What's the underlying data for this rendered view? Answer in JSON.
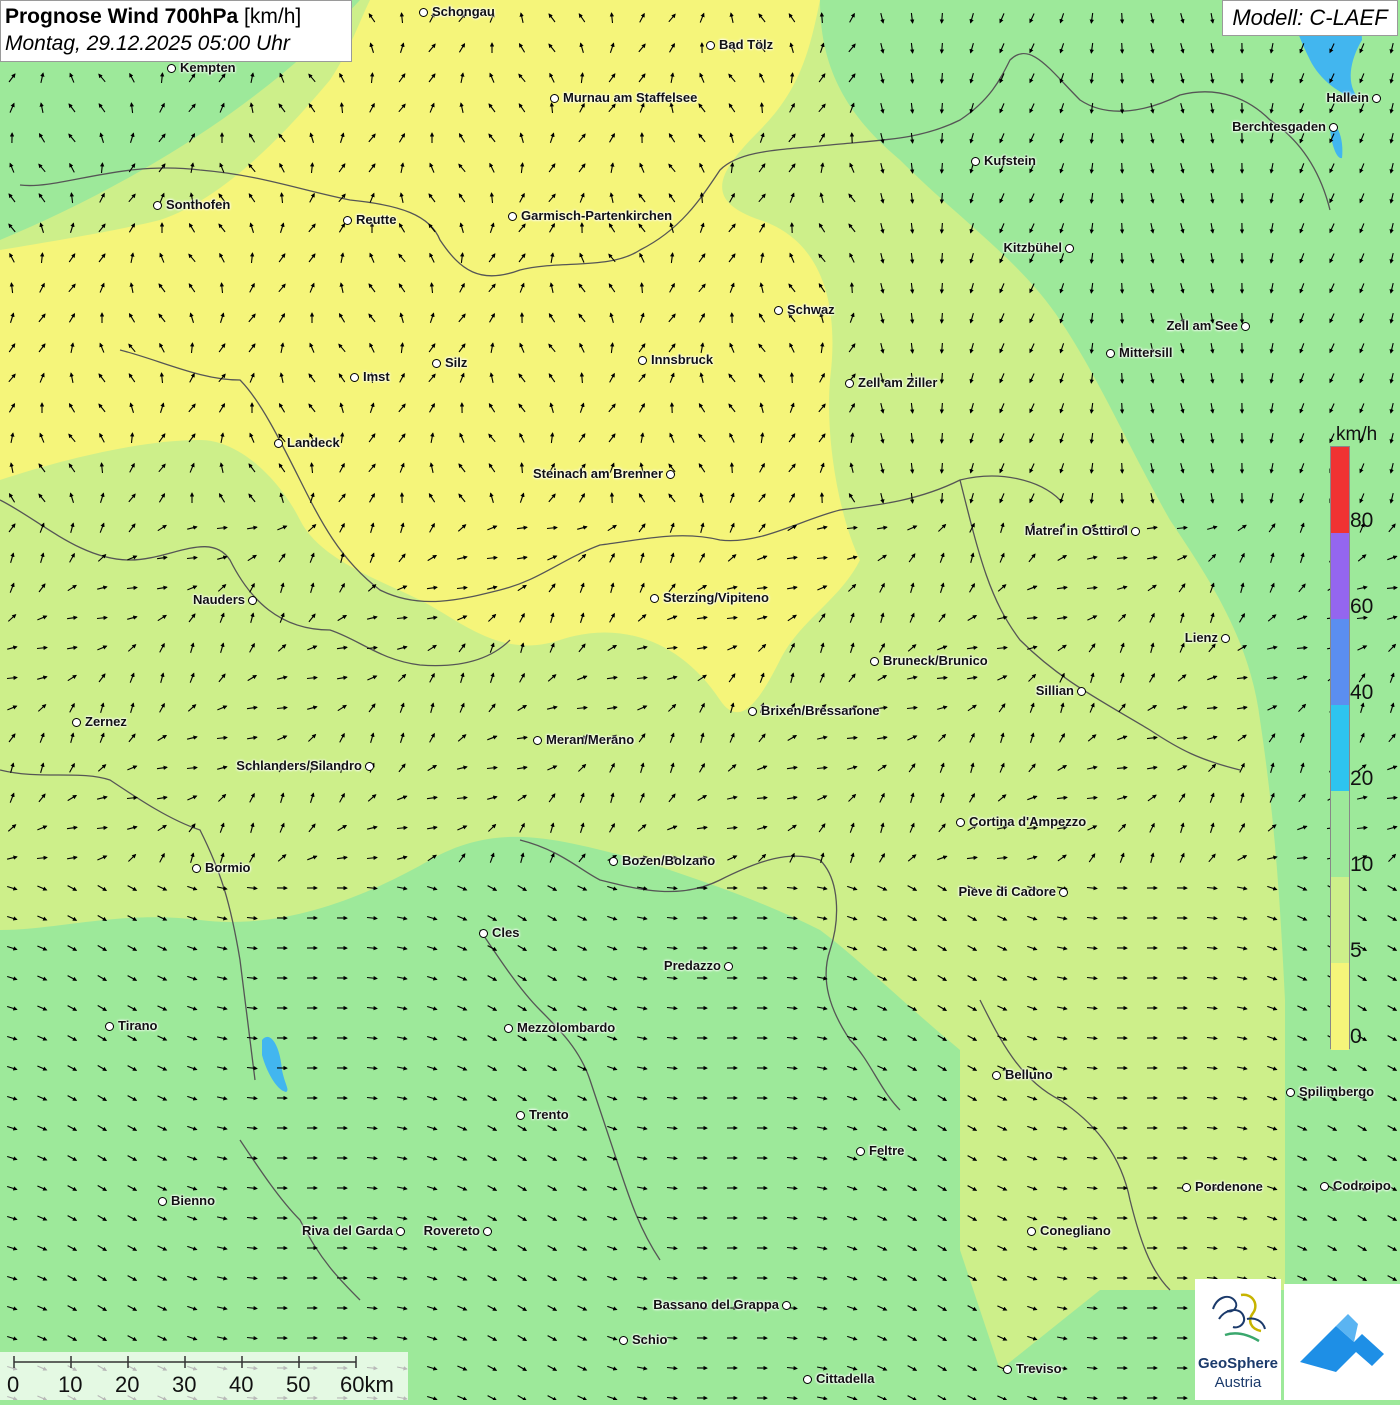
{
  "header": {
    "title_bold": "Prognose Wind 700hPa",
    "title_unit": "[km/h]",
    "datetime": "Montag, 29.12.2025 05:00 Uhr"
  },
  "model_label": "Modell: C-LAEF",
  "colors": {
    "wind_0_5": "#f5f57a",
    "wind_5_10": "#cdef8a",
    "wind_10_20": "#9de99a",
    "wind_20_40": "#2ec4ef",
    "wind_40_60": "#5b8ef0",
    "wind_60_80": "#9466ef",
    "wind_80_plus": "#f03232",
    "lake": "#42b6ef",
    "border": "#555555"
  },
  "legend": {
    "unit": "km/h",
    "ticks": [
      "0",
      "5",
      "10",
      "20",
      "40",
      "60",
      "80"
    ]
  },
  "scalebar": {
    "labels": [
      "0",
      "10",
      "20",
      "30",
      "40",
      "50",
      "60km"
    ]
  },
  "cities": [
    {
      "name": "Schongau"
    },
    {
      "name": "Kempten"
    },
    {
      "name": "Bad Tölz"
    },
    {
      "name": "Murnau am Staffelsee"
    },
    {
      "name": "Hallein"
    },
    {
      "name": "Berchtesgaden"
    },
    {
      "name": "Kufstein"
    },
    {
      "name": "Sonthofen"
    },
    {
      "name": "Reutte"
    },
    {
      "name": "Garmisch-Partenkirchen"
    },
    {
      "name": "Kitzbühel"
    },
    {
      "name": "Schwaz"
    },
    {
      "name": "Zell am See"
    },
    {
      "name": "Mittersill"
    },
    {
      "name": "Innsbruck"
    },
    {
      "name": "Silz"
    },
    {
      "name": "Imst"
    },
    {
      "name": "Zell am Ziller"
    },
    {
      "name": "Landeck"
    },
    {
      "name": "Steinach am Brenner"
    },
    {
      "name": "Matrei in Osttirol"
    },
    {
      "name": "Nauders"
    },
    {
      "name": "Sterzing/Vipiteno"
    },
    {
      "name": "Lienz"
    },
    {
      "name": "Bruneck/Brunico"
    },
    {
      "name": "Sillian"
    },
    {
      "name": "Zernez"
    },
    {
      "name": "Brixen/Bressanone"
    },
    {
      "name": "Meran/Merano"
    },
    {
      "name": "Schlanders/Silandro"
    },
    {
      "name": "Cortina d'Ampezzo"
    },
    {
      "name": "Bormio"
    },
    {
      "name": "Bozen/Bolzano"
    },
    {
      "name": "Pieve di Cadore"
    },
    {
      "name": "Cles"
    },
    {
      "name": "Predazzo"
    },
    {
      "name": "Tirano"
    },
    {
      "name": "Mezzolombardo"
    },
    {
      "name": "Belluno"
    },
    {
      "name": "Spilimbergo"
    },
    {
      "name": "Trento"
    },
    {
      "name": "Feltre"
    },
    {
      "name": "Pordenone"
    },
    {
      "name": "Codroipo"
    },
    {
      "name": "Bienno"
    },
    {
      "name": "Riva del Garda"
    },
    {
      "name": "Rovereto"
    },
    {
      "name": "Conegliano"
    },
    {
      "name": "Bassano del Grappa"
    },
    {
      "name": "Schio"
    },
    {
      "name": "Treviso"
    },
    {
      "name": "Cittadella"
    }
  ],
  "logos": {
    "geosphere_line1": "GeoSphere",
    "geosphere_line2": "Austria"
  }
}
